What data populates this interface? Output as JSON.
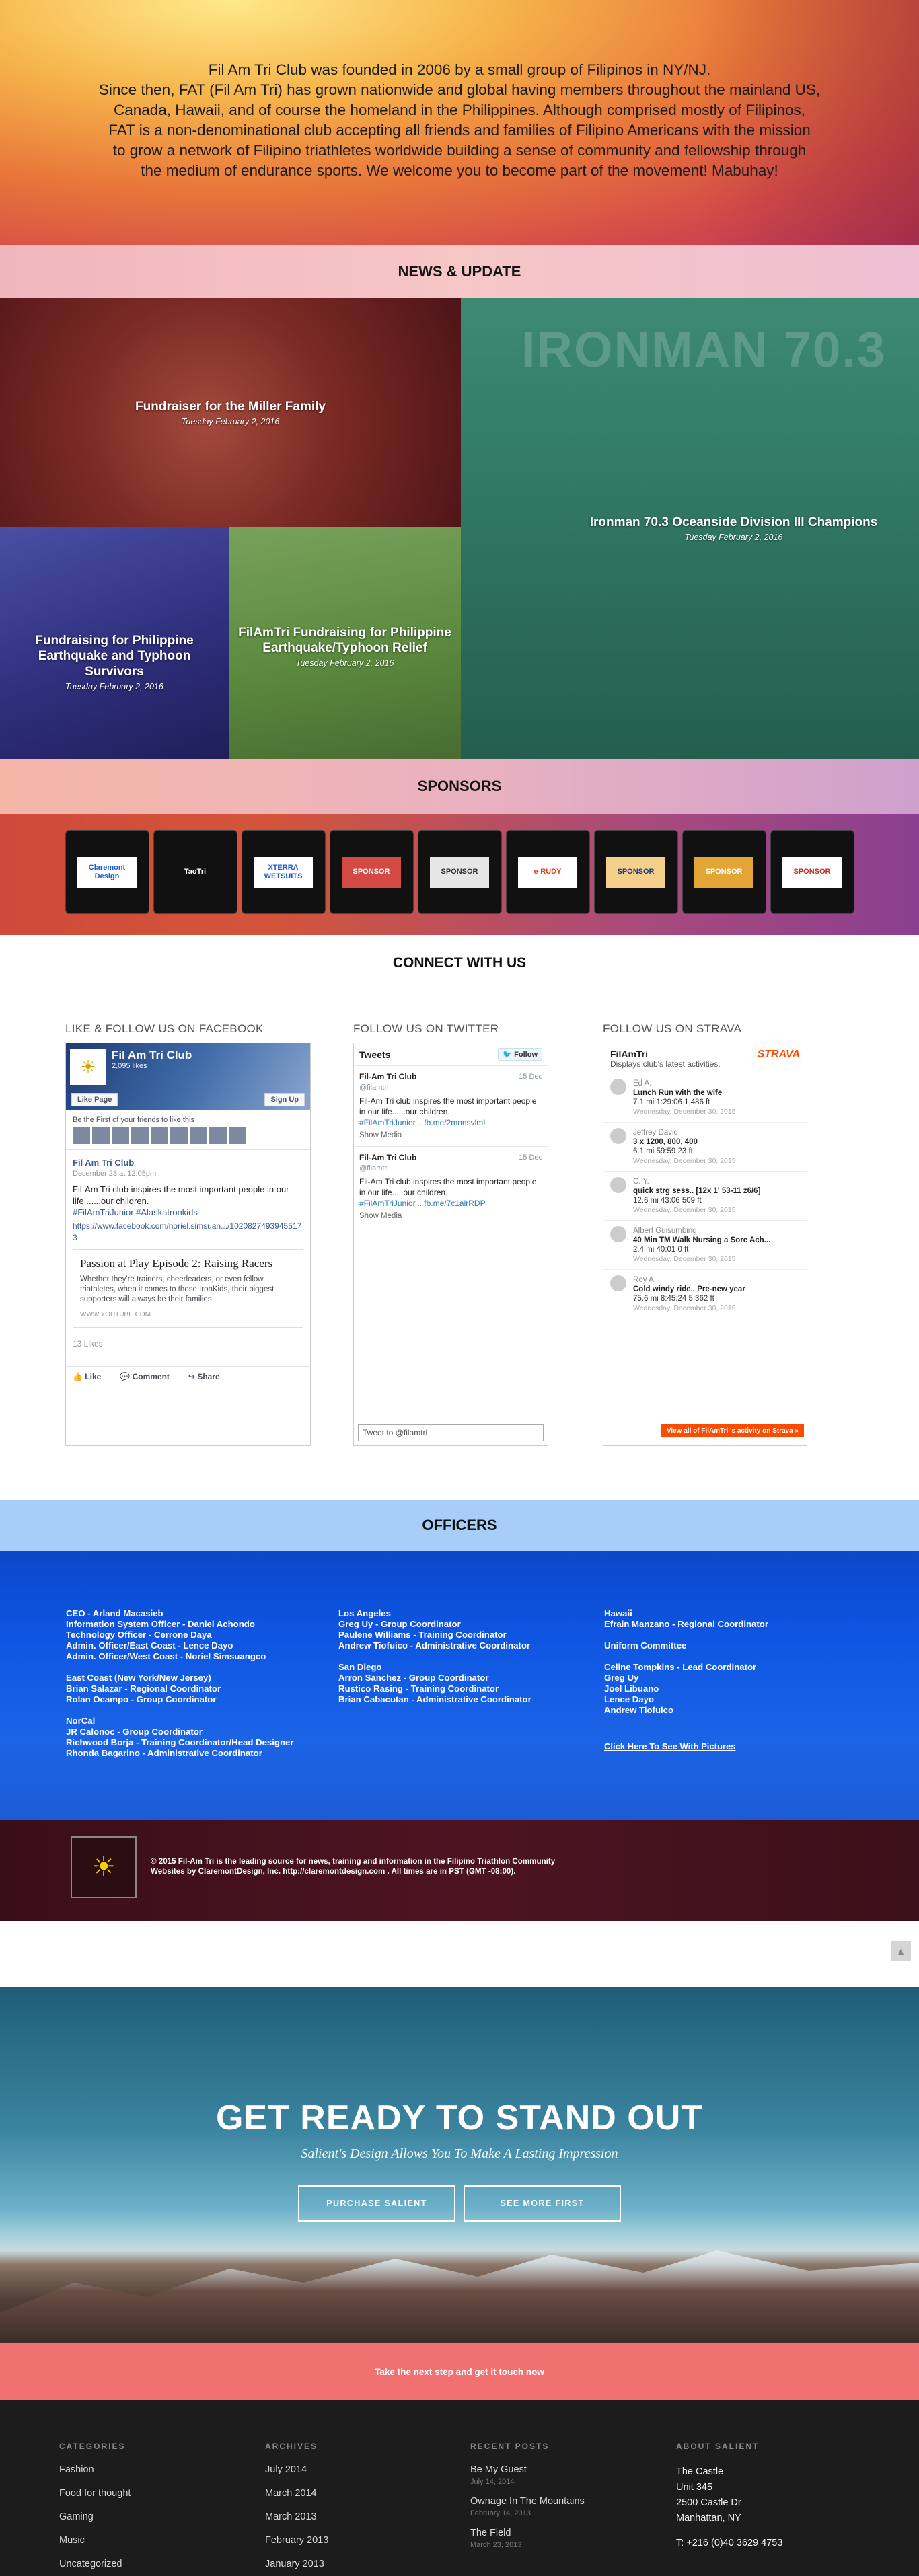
{
  "hero": {
    "lines": [
      "Fil Am Tri Club was founded in 2006 by a small group of Filipinos in NY/NJ.",
      "Since then, FAT (Fil Am Tri) has grown nationwide and global having members throughout the mainland US,",
      "Canada, Hawaii, and of course the homeland in the Philippines. Although comprised mostly of Filipinos,",
      "FAT is a non-denominational club accepting all friends and families of Filipino Americans with the mission",
      "to grow a network of Filipino triathletes worldwide building a sense of community and fellowship through",
      "the medium of endurance sports. We welcome you to become part of the movement! Mabuhay!"
    ]
  },
  "news": {
    "heading": "NEWS & UPDATE",
    "items": [
      {
        "title": "Fundraiser for the Miller Family",
        "date": "Tuesday February 2, 2016"
      },
      {
        "title": "Fundraising for Philippine Earthquake and Typhoon Survivors",
        "date": "Tuesday February 2, 2016"
      },
      {
        "title": "FilAmTri Fundraising for Philippine Earthquake/Typhoon Relief",
        "date": "Tuesday February 2, 2016"
      },
      {
        "title": "Ironman 70.3 Oceanside Division III Champions",
        "date": "Tuesday February 2, 2016"
      }
    ],
    "ironman_mark": "IRONMAN 70.3"
  },
  "sponsors": {
    "heading": "SPONSORS",
    "logos": [
      {
        "text": "Claremont Design",
        "color": "#1a5fd0",
        "bg": "#ffffff"
      },
      {
        "text": "TaoTri",
        "color": "#ffffff",
        "bg": "#111111"
      },
      {
        "text": "XTERRA WETSUITS",
        "color": "#1a5fd0",
        "bg": "#ffffff"
      },
      {
        "text": "SPONSOR",
        "color": "#ffffff",
        "bg": "#d24a43"
      },
      {
        "text": "SPONSOR",
        "color": "#333333",
        "bg": "#e6e6e6"
      },
      {
        "text": "e-RUDY",
        "color": "#e4431b",
        "bg": "#ffffff"
      },
      {
        "text": "SPONSOR",
        "color": "#1f3a8a",
        "bg": "#f5d08a"
      },
      {
        "text": "SPONSOR",
        "color": "#ffffff",
        "bg": "#e2a536"
      },
      {
        "text": "SPONSOR",
        "color": "#c12a2a",
        "bg": "#ffffff"
      }
    ]
  },
  "connect": {
    "heading": "CONNECT WITH US",
    "facebook_head": "LIKE & FOLLOW US ON FACEBOOK",
    "twitter_head": "FOLLOW US ON TWITTER",
    "strava_head": "FOLLOW US ON STRAVA",
    "facebook": {
      "page_title": "Fil Am Tri Club",
      "likes": "2,095 likes",
      "like_btn": "Like Page",
      "signup_btn": "Sign Up",
      "friends_text": "Be the First of your friends to like this",
      "poster": "Fil Am Tri Club",
      "post_date": "December 23 at 12:05pm",
      "post_text": "Fil-Am Tri club inspires the most important people in our life.......our children.",
      "post_tags": "#FilAmTriJunior #Alaskatronkids",
      "post_link": "https://www.facebook.com/noriel.simsuan.../1020827493945517​3",
      "card_title": "Passion at Play Episode 2: Raising Racers",
      "card_desc": "Whether they're trainers, cheerleaders, or even fellow triathletes, when it comes to these IronKids, their biggest supporters will always be their families.",
      "card_src": "WWW.YOUTUBE.COM",
      "likes_count": "13 Likes",
      "like": "Like",
      "comment": "Comment",
      "share": "Share"
    },
    "twitter": {
      "title": "Tweets",
      "follow": "Follow",
      "tweets": [
        {
          "who": "Fil-Am Tri Club",
          "handle": "@filamtri",
          "when": "15 Dec",
          "text": "Fil-Am Tri club inspires the most important people in our life......our children.",
          "link": "#FilAmTriJunior... fb.me/2mnnsvlmI",
          "media": "Show Media"
        },
        {
          "who": "Fil-Am Tri Club",
          "handle": "@filamtri",
          "when": "15 Dec",
          "text": "Fil-Am Tri club inspires the most important people in our life.....our children.",
          "link": "#FilAmTriJunior... fb.me/7c1alrRDP",
          "media": "Show Media"
        }
      ],
      "input": "Tweet to @filamtri"
    },
    "strava": {
      "club": "FilAmTri",
      "logo": "STRAVA",
      "subtitle": "Displays club's latest activities.",
      "button": "View all of FilAmTri 's activity on Strava »",
      "rows": [
        {
          "name": "Ed A.",
          "activity": "Lunch Run with the wife",
          "stats": "7.1 mi    1:29:06    1,486 ft",
          "date": "Wednesday, December 30, 2015"
        },
        {
          "name": "Jeffrey David",
          "activity": "3 x 1200, 800, 400",
          "stats": "6.1 mi    59:59    23 ft",
          "date": "Wednesday, December 30, 2015"
        },
        {
          "name": "C. Y.",
          "activity": "quick strg sess.. [12x 1' 53-11 z6/6]",
          "stats": "12.6 mi    43:06    509 ft",
          "date": "Wednesday, December 30, 2015"
        },
        {
          "name": "Albert Guisumbing",
          "activity": "40 Min TM Walk Nursing a Sore Ach...",
          "stats": "2.4 mi    40:01    0 ft",
          "date": "Wednesday, December 30, 2015"
        },
        {
          "name": "Roy A.",
          "activity": "Cold windy ride.. Pre-new year",
          "stats": "75.6 mi    8:45:24    5,362 ft",
          "date": "Wednesday, December 30, 2015"
        }
      ]
    }
  },
  "officers": {
    "heading": "OFFICERS",
    "col1": [
      "CEO - Arland Macasieb",
      "Information System Officer - Daniel Achondo",
      "Technology Officer - Cerrone Daya",
      "Admin. Officer/East Coast - Lence Dayo",
      "Admin. Officer/West Coast - Noriel Simsuangco",
      "",
      "East Coast (New York/New Jersey)",
      "Brian Salazar - Regional Coordinator",
      "Rolan Ocampo - Group Coordinator",
      "",
      "NorCal",
      "JR Calonoc - Group Coordinator",
      "Richwood Borja - Training Coordinator/Head Designer",
      "Rhonda Bagarino - Administrative Coordinator"
    ],
    "col2": [
      "Los Angeles",
      "Greg Uy - Group Coordinator",
      "Paulene Williams - Training Coordinator",
      "Andrew Tiofuico - Administrative Coordinator",
      "",
      "San Diego",
      "Arron Sanchez - Group Coordinator",
      "Rustico Rasing - Training Coordinator",
      "Brian Cabacutan - Administrative Coordinator"
    ],
    "col3": [
      "Hawaii",
      "Efrain Manzano - Regional Coordinator",
      "",
      "Uniform Committee",
      "",
      "Celine Tompkins - Lead Coordinator",
      "Greg Uy",
      "Joel Libuano",
      "Lence Dayo",
      "Andrew Tiofuico"
    ],
    "link": "Click Here To See With Pictures"
  },
  "maroon": {
    "line1": "© 2015 Fil-Am Tri is the leading source for news, training and information in the Filipino Triathlon Community",
    "line2": "Websites by ClaremontDesign, Inc. http://claremontdesign.com . All times are in PST (GMT -08:00)."
  },
  "up_icon": "▲",
  "salient": {
    "title": "GET READY TO STAND OUT",
    "subtitle": "Salient's Design Allows You To Make A Lasting Impression",
    "btn1": "PURCHASE SALIENT",
    "btn2": "SEE MORE FIRST"
  },
  "cta": "Take the next step and get it touch now",
  "footer": {
    "categories": {
      "head": "CATEGORIES",
      "items": [
        "Fashion",
        "Food for thought",
        "Gaming",
        "Music",
        "Uncategorized"
      ]
    },
    "archives": {
      "head": "ARCHIVES",
      "items": [
        "July 2014",
        "March 2014",
        "March 2013",
        "February 2013",
        "January 2013"
      ]
    },
    "recent": {
      "head": "RECENT POSTS",
      "items": [
        {
          "title": "Be My Guest",
          "date": "July 14, 2014"
        },
        {
          "title": "Ownage In The Mountains",
          "date": "February 14, 2013"
        },
        {
          "title": "The Field",
          "date": "March 23, 2013"
        }
      ]
    },
    "about": {
      "head": "ABOUT SALIENT",
      "lines": [
        "The Castle",
        "Unit 345",
        "2500 Castle Dr",
        "Manhattan, NY",
        "",
        "T: +216 (0)40 3629 4753"
      ]
    }
  }
}
